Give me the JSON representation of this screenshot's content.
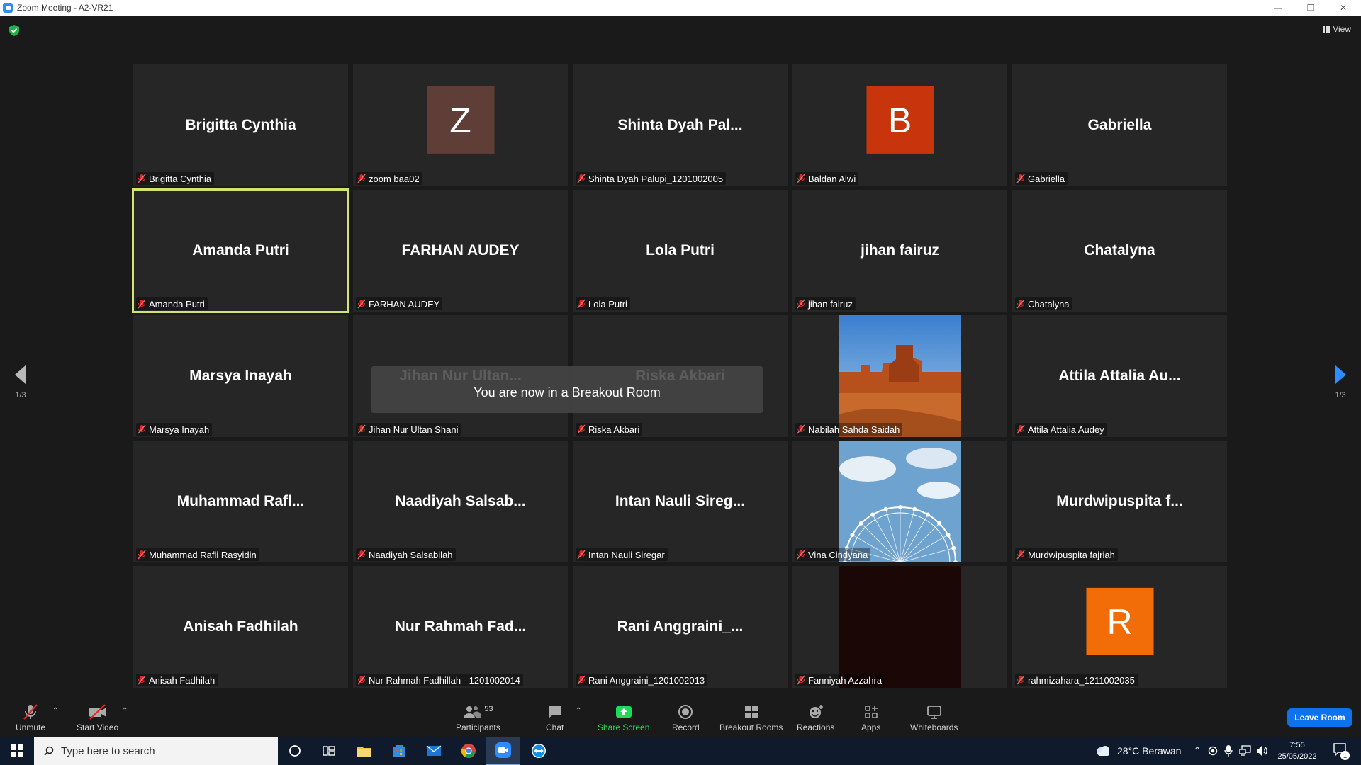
{
  "window": {
    "title": "Zoom Meeting - A2-VR21"
  },
  "view_button": {
    "label": "View"
  },
  "tiles": [
    {
      "display_name": "Brigitta Cynthia",
      "label": "Brigitta Cynthia",
      "kind": "name"
    },
    {
      "display_name": "",
      "label": "zoom baa02",
      "kind": "avatar",
      "initial": "Z",
      "avatar_color": "#5e3e37"
    },
    {
      "display_name": "Shinta  Dyah  Pal...",
      "label": "Shinta Dyah Palupi_1201002005",
      "kind": "name"
    },
    {
      "display_name": "",
      "label": "Baldan Alwi",
      "kind": "avatar",
      "initial": "B",
      "avatar_color": "#c8340b"
    },
    {
      "display_name": "Gabriella",
      "label": "Gabriella",
      "kind": "name"
    },
    {
      "display_name": "Amanda Putri",
      "label": "Amanda Putri",
      "kind": "name",
      "active": true
    },
    {
      "display_name": "FARHAN AUDEY",
      "label": "FARHAN AUDEY",
      "kind": "name"
    },
    {
      "display_name": "Lola Putri",
      "label": "Lola Putri",
      "kind": "name"
    },
    {
      "display_name": "jihan fairuz",
      "label": "jihan fairuz",
      "kind": "name"
    },
    {
      "display_name": "Chatalyna",
      "label": "Chatalyna",
      "kind": "name"
    },
    {
      "display_name": "Marsya Inayah",
      "label": "Marsya Inayah",
      "kind": "name"
    },
    {
      "display_name": "Jihan  Nur  Ultan...",
      "label": "Jihan Nur Ultan Shani",
      "kind": "name"
    },
    {
      "display_name": "Riska Akbari",
      "label": "Riska Akbari",
      "kind": "name"
    },
    {
      "display_name": "",
      "label": "Nabilah Sahda Saidah",
      "kind": "photo-desert"
    },
    {
      "display_name": "Attila  Attalia  Au...",
      "label": "Attila Attalia Audey",
      "kind": "name"
    },
    {
      "display_name": "Muhammad  Rafl...",
      "label": "Muhammad Rafli Rasyidin",
      "kind": "name"
    },
    {
      "display_name": "Naadiyah  Salsab...",
      "label": "Naadiyah Salsabilah",
      "kind": "name"
    },
    {
      "display_name": "Intan  Nauli  Sireg...",
      "label": "Intan Nauli Siregar",
      "kind": "name"
    },
    {
      "display_name": "",
      "label": "Vina Cindyana",
      "kind": "photo-wheel"
    },
    {
      "display_name": "Murdwipuspita  f...",
      "label": "Murdwipuspita fajriah",
      "kind": "name"
    },
    {
      "display_name": "Anisah Fadhilah",
      "label": "Anisah Fadhilah",
      "kind": "name"
    },
    {
      "display_name": "Nur  Rahmah  Fad...",
      "label": "Nur Rahmah Fadhillah - 1201002014",
      "kind": "name"
    },
    {
      "display_name": "Rani  Anggraini_...",
      "label": "Rani Anggraini_1201002013",
      "kind": "name"
    },
    {
      "display_name": "",
      "label": "Fanniyah Azzahra",
      "kind": "photo-dark"
    },
    {
      "display_name": "",
      "label": "rahmizahara_1211002035",
      "kind": "avatar",
      "initial": "R",
      "avatar_color": "#f26d07"
    }
  ],
  "breakout_message": "You are now in a Breakout Room",
  "pagination": {
    "left": "1/3",
    "right": "1/3"
  },
  "toolbar": {
    "unmute": "Unmute",
    "start_video": "Start Video",
    "participants": "Participants",
    "participants_count": "53",
    "chat": "Chat",
    "share_screen": "Share Screen",
    "record": "Record",
    "breakout_rooms": "Breakout Rooms",
    "reactions": "Reactions",
    "apps": "Apps",
    "whiteboards": "Whiteboards",
    "leave_room": "Leave Room"
  },
  "taskbar": {
    "search_placeholder": "Type here to search",
    "weather": "28°C  Berawan",
    "time": "7:55",
    "date": "25/05/2022",
    "notification_count": "1"
  },
  "colors": {
    "accent_blue": "#0e72ed",
    "active_speaker": "#d4e36b",
    "share_green": "#23d959",
    "muted_red": "#e02828"
  }
}
